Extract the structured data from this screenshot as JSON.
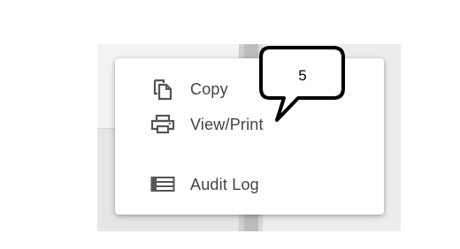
{
  "context_menu": {
    "items": [
      {
        "label": "Copy",
        "icon": "copy-icon"
      },
      {
        "label": "View/Print",
        "icon": "print-icon"
      },
      {
        "label": "Audit Log",
        "icon": "list-icon"
      }
    ]
  },
  "callout": {
    "number": "5"
  },
  "colors": {
    "menu_text": "#444444",
    "icon": "#555555",
    "background_gray": "#e6e6e6",
    "menu_bg": "#ffffff"
  }
}
